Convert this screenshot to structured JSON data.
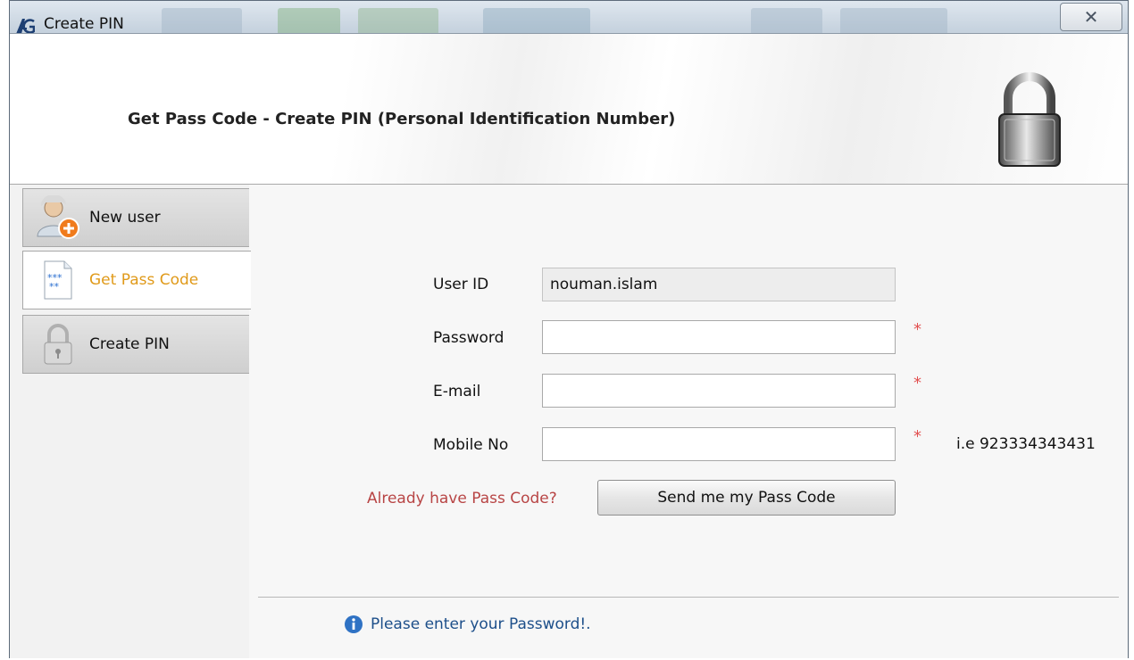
{
  "window": {
    "title": "Create PIN",
    "close_glyph": "✕",
    "app_icon": "ag-app-icon"
  },
  "header": {
    "title": "Get Pass Code - Create PIN (Personal Identification Number)",
    "icon": "padlock-icon"
  },
  "sidebar": {
    "items": [
      {
        "label": "New user",
        "icon": "new-user-icon",
        "active": false
      },
      {
        "label": "Get Pass Code",
        "icon": "pass-code-icon",
        "active": true
      },
      {
        "label": "Create PIN",
        "icon": "lock-small-icon",
        "active": false
      }
    ]
  },
  "form": {
    "user_id_label": "User ID",
    "user_id_value": "nouman.islam",
    "password_label": "Password",
    "password_value": "",
    "email_label": "E-mail",
    "email_value": "",
    "mobile_label": "Mobile No",
    "mobile_value": "",
    "required_mark": "*",
    "mobile_hint": "i.e 923334343431",
    "already_link": "Already have Pass Code?",
    "send_button": "Send me my Pass Code"
  },
  "status": {
    "message": "Please enter your Password!.",
    "icon": "info-icon"
  },
  "colors": {
    "active_nav_text": "#e09a1a",
    "link": "#b84545",
    "required": "#e25050",
    "status_text": "#1d4f8a"
  }
}
